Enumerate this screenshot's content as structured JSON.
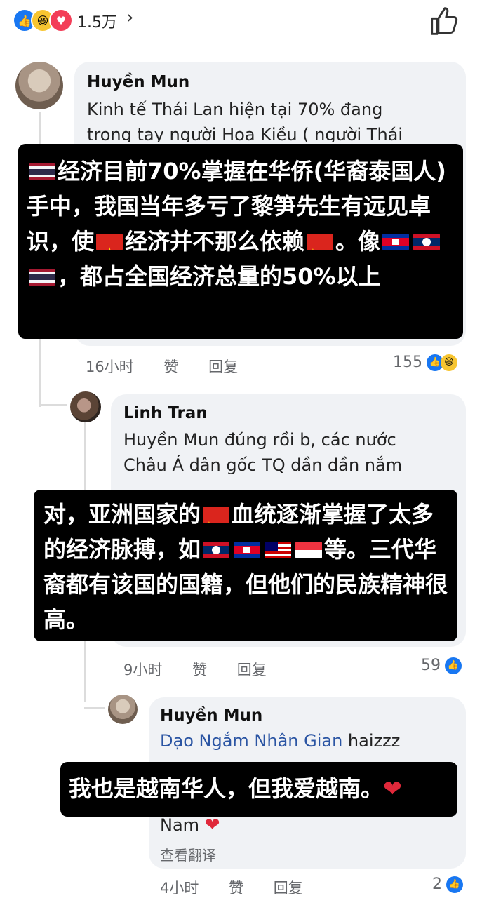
{
  "top_bar": {
    "reaction_count": "1.5万",
    "reaction_icons": [
      "like-icon",
      "haha-icon",
      "love-icon"
    ],
    "chevron": "›"
  },
  "comment1": {
    "name": "Huyền Mun",
    "text_line1": "Kinh tế Thái Lan hiện tại 70% đang",
    "text_line2": "trong tay người Hoa Kiều ( người Thái",
    "time": "16小时",
    "like": "赞",
    "reply": "回复",
    "reaction_count": "155"
  },
  "overlay1": {
    "p1": "经济目前70%掌握在华侨(华裔泰国人)手中，我国当年多亏了黎笋先生有远见卓识，使",
    "p2": "经济并不那么依赖",
    "p3": "。像",
    "p4": "，都占全国经济总量的50%以上"
  },
  "comment2": {
    "name": "Linh Tran",
    "text_line1": "Huyền Mun đúng rồi b, các nước",
    "text_line2": "Châu Á dân gốc TQ dần dần nắm",
    "time": "9小时",
    "like": "赞",
    "reply": "回复",
    "reaction_count": "59"
  },
  "overlay2": {
    "p1": "对，亚洲国家的",
    "p2": "血统逐渐掌握了太多的经济脉搏，如",
    "p3": "等。三代华裔都有该国的国籍，但他们的民族精神很高。"
  },
  "comment3": {
    "name": "Huyền Mun",
    "tagged": "Dạo Ngắm Nhân Gian",
    "text_after": " haizzz",
    "text_last": "Nam",
    "translate": "查看翻译",
    "time": "4小时",
    "like": "赞",
    "reply": "回复",
    "reaction_count": "2"
  },
  "overlay3": {
    "text": "我也是越南华人，但我爱越南。",
    "heart": "❤️"
  },
  "colors": {
    "like_blue": "#1877f2",
    "bubble_gray": "#f0f2f5",
    "overlay_black": "#000000",
    "tag_blue": "#2b55a3"
  }
}
